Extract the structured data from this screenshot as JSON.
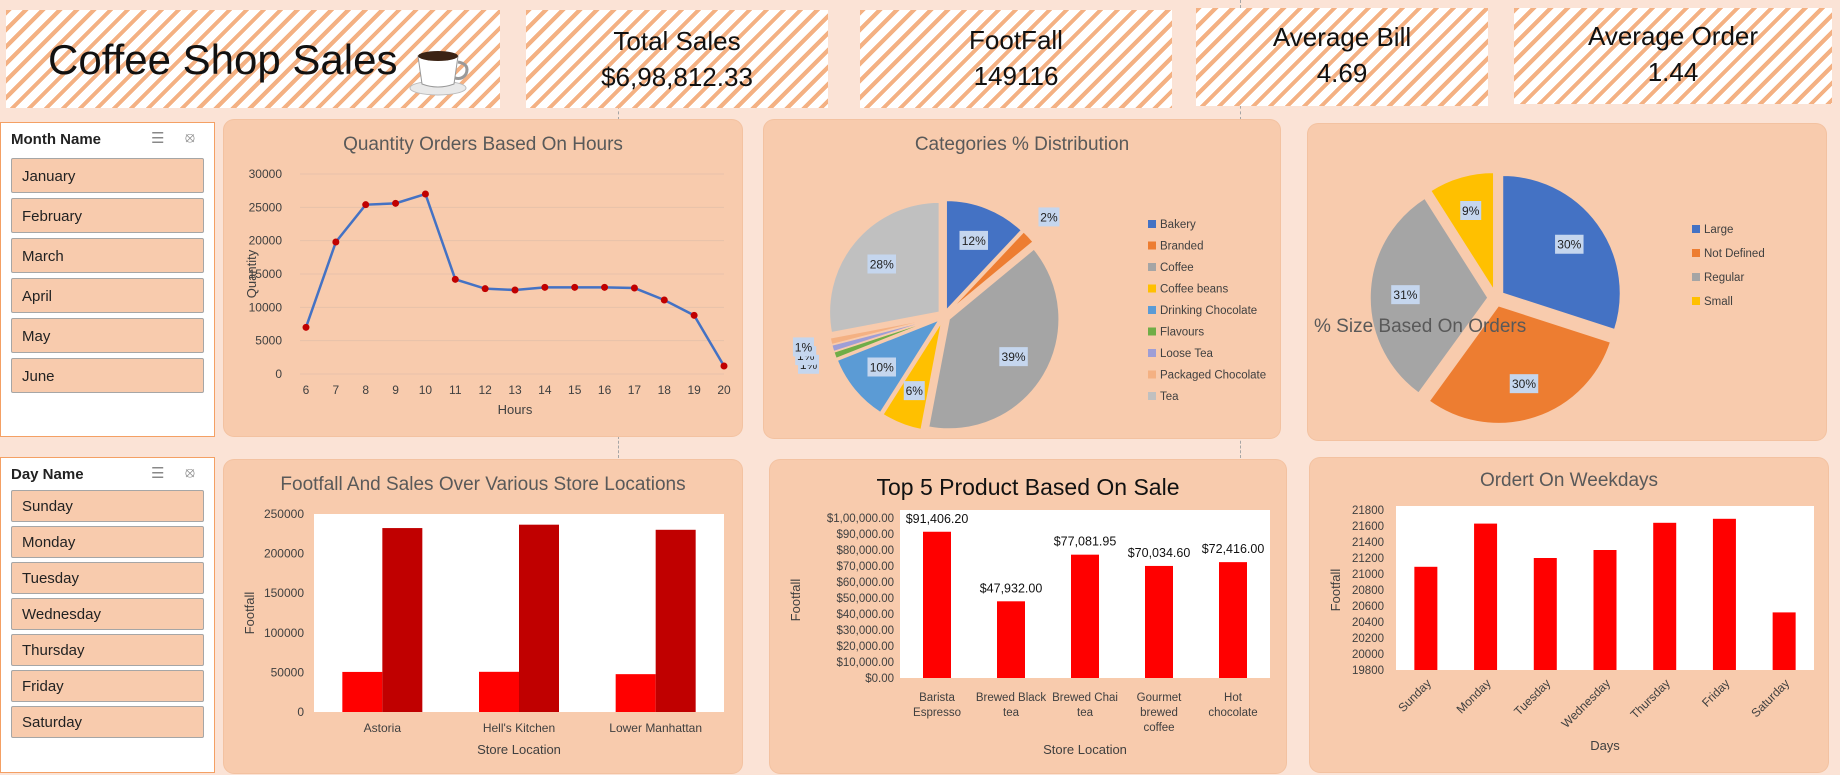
{
  "header": {
    "title": "Coffee Shop Sales"
  },
  "kpis": [
    {
      "label": "Total Sales",
      "value": "$6,98,812.33"
    },
    {
      "label": "FootFall",
      "value": "149116"
    },
    {
      "label": "Average Bill",
      "value": "4.69"
    },
    {
      "label": "Average Order",
      "value": "1.44"
    }
  ],
  "slicers": {
    "month": {
      "title": "Month Name",
      "items": [
        "January",
        "February",
        "March",
        "April",
        "May",
        "June"
      ]
    },
    "day": {
      "title": "Day Name",
      "items": [
        "Sunday",
        "Monday",
        "Tuesday",
        "Wednesday",
        "Thursday",
        "Friday",
        "Saturday"
      ]
    }
  },
  "icons": {
    "multi_select": "multi-select-icon",
    "clear_filter": "clear-filter-icon",
    "coffee": "coffee-cup-icon"
  },
  "colors": {
    "background": "#fbe3d6",
    "card": "#f8cbad",
    "accent": "#f4b183",
    "bar_red": "#ff0000",
    "bar_dark_red": "#c00000",
    "line_blue": "#4472c4"
  },
  "chart_data": [
    {
      "id": "hours",
      "type": "line",
      "title": "Quantity Orders Based On Hours",
      "xlabel": "Hours",
      "ylabel": "Quantity",
      "x": [
        "6",
        "7",
        "8",
        "9",
        "10",
        "11",
        "12",
        "13",
        "14",
        "15",
        "16",
        "17",
        "18",
        "19",
        "20"
      ],
      "values": [
        7000,
        19800,
        25400,
        25600,
        27000,
        14200,
        12800,
        12600,
        13000,
        13000,
        13000,
        12900,
        11100,
        8800,
        1200
      ],
      "ylim": [
        0,
        30000
      ],
      "yticks": [
        "0",
        "5000",
        "10000",
        "15000",
        "20000",
        "25000",
        "30000"
      ]
    },
    {
      "id": "categories",
      "type": "pie",
      "title": "Categories % Distribution",
      "labels": [
        "Bakery",
        "Branded",
        "Coffee",
        "Coffee beans",
        "Drinking Chocolate",
        "Flavours",
        "Loose Tea",
        "Packaged Chocolate",
        "Tea"
      ],
      "values": [
        12,
        2,
        39,
        6,
        10,
        1,
        1,
        1,
        28
      ],
      "data_labels": [
        "12%",
        "2%",
        "39%",
        "6%",
        "10%",
        "1%",
        "1%",
        "1%",
        "28%"
      ],
      "colors": [
        "#4472c4",
        "#ed7d31",
        "#a5a5a5",
        "#ffc000",
        "#5b9bd5",
        "#70ad47",
        "#9e9ed6",
        "#f4b183",
        "#c0c0c0"
      ],
      "legend": "right"
    },
    {
      "id": "size",
      "type": "pie",
      "title": "% Size Based On Orders",
      "labels": [
        "Large",
        "Not Defined",
        "Regular",
        "Small"
      ],
      "values": [
        30,
        30,
        31,
        9
      ],
      "data_labels": [
        "30%",
        "30%",
        "31%",
        "9%"
      ],
      "colors": [
        "#4472c4",
        "#ed7d31",
        "#a5a5a5",
        "#ffc000"
      ],
      "legend": "right"
    },
    {
      "id": "locations",
      "type": "bar",
      "title": "Footfall And Sales Over Various Store Locations",
      "xlabel": "Store Location",
      "ylabel": "Footfall",
      "categories": [
        "Astoria",
        "Hell's Kitchen",
        "Lower Manhattan"
      ],
      "series": [
        {
          "values": [
            50599,
            50735,
            47782
          ]
        },
        {
          "values": [
            232244,
            236511,
            230057
          ]
        }
      ],
      "ylim": [
        0,
        250000
      ],
      "yticks": [
        "0",
        "50000",
        "100000",
        "150000",
        "200000",
        "250000"
      ]
    },
    {
      "id": "products",
      "type": "bar",
      "title": "Top 5 Product Based On Sale",
      "xlabel": "Store Location",
      "ylabel": "Footfall",
      "categories": [
        "Barista Espresso",
        "Brewed Black tea",
        "Brewed Chai tea",
        "Gourmet brewed coffee",
        "Hot chocolate"
      ],
      "category_lines": [
        [
          "Barista",
          "Espresso"
        ],
        [
          "Brewed Black",
          "tea"
        ],
        [
          "Brewed Chai",
          "tea"
        ],
        [
          "Gourmet",
          "brewed",
          "coffee"
        ],
        [
          "Hot",
          "chocolate"
        ]
      ],
      "values": [
        91406.2,
        47932,
        77081.95,
        70034.6,
        72416
      ],
      "data_labels": [
        "$91,406.20",
        "$47,932.00",
        "$77,081.95",
        "$70,034.60",
        "$72,416.00"
      ],
      "ylim": [
        0,
        100000
      ],
      "yticks": [
        "$0.00",
        "$10,000.00",
        "$20,000.00",
        "$30,000.00",
        "$40,000.00",
        "$50,000.00",
        "$60,000.00",
        "$70,000.00",
        "$80,000.00",
        "$90,000.00",
        "$1,00,000.00"
      ]
    },
    {
      "id": "weekdays",
      "type": "bar",
      "title": "Ordert On Weekdays",
      "xlabel": "Days",
      "ylabel": "Footfall",
      "categories": [
        "Sunday",
        "Monday",
        "Tuesday",
        "Wednesday",
        "Thursday",
        "Friday",
        "Saturday"
      ],
      "values": [
        21090,
        21630,
        21200,
        21300,
        21640,
        21690,
        20520
      ],
      "ylim": [
        19800,
        21800
      ],
      "yticks": [
        "19800",
        "20000",
        "20200",
        "20400",
        "20600",
        "20800",
        "21000",
        "21200",
        "21400",
        "21600",
        "21800"
      ]
    }
  ]
}
